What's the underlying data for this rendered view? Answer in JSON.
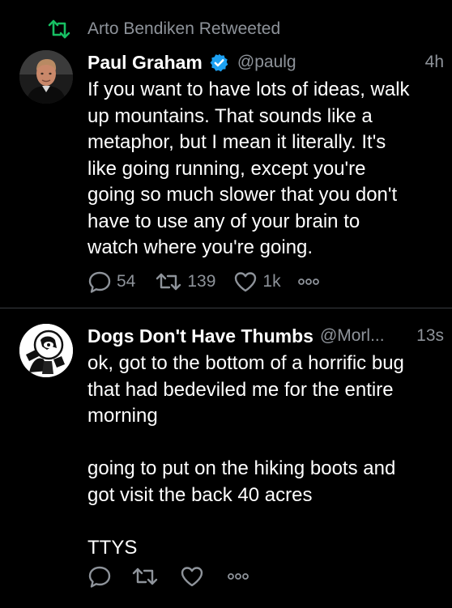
{
  "tweets": [
    {
      "retweet_notice": "Arto Bendiken Retweeted",
      "author_name": "Paul Graham",
      "verified": true,
      "handle": "@paulg",
      "time": "4h",
      "text": "If you want to have lots of ideas, walk\nup mountains. That sounds like a\nmetaphor, but I mean it literally. It's\nlike going running, except you're\ngoing so much slower that you don't\nhave to use any of your brain to\nwatch where you're going.",
      "actions": {
        "replies": "54",
        "retweets": "139",
        "likes": "1k"
      }
    },
    {
      "author_name": "Dogs Don't Have Thumbs",
      "verified": false,
      "handle": "@Morl...",
      "time": "13s",
      "text": "ok, got to the bottom of a horrific bug\nthat had bedeviled me for the entire\nmorning\n\ngoing to put on the hiking boots and\ngot visit the back 40 acres\n\nTTYS",
      "actions": {
        "replies": "",
        "retweets": "",
        "likes": ""
      }
    }
  ],
  "colors": {
    "background": "#000000",
    "text": "#ffffff",
    "secondary_text": "#8e939a",
    "retweet_green": "#17bf63",
    "verified_blue": "#1da1f2",
    "divider": "#3a3d42"
  },
  "icons": {
    "retweet": "retweet-icon",
    "verified": "verified-badge-icon",
    "reply": "reply-icon",
    "like": "like-icon",
    "more": "more-icon"
  }
}
